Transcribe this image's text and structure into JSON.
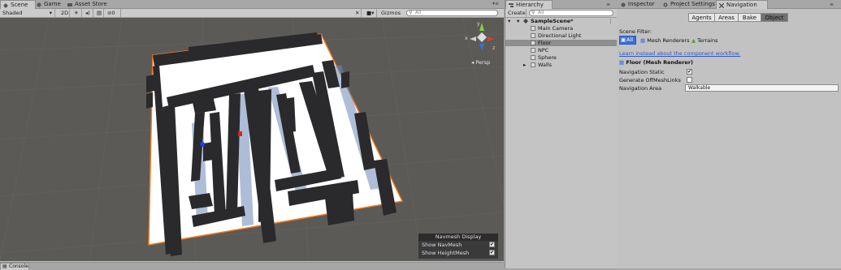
{
  "scene_tabs": {
    "scene": "Scene",
    "game": "Game",
    "asset_store": "Asset Store"
  },
  "scene_toolbar": {
    "shading": "Shaded",
    "mode_2d": "2D",
    "gizmos": "Gizmos",
    "search_placeholder": "All"
  },
  "scene_view": {
    "projection": "Persp",
    "axis_y": "y",
    "axis_x": "x",
    "axis_z": "z"
  },
  "navmesh_display": {
    "title": "Navmesh Display",
    "show_navmesh": "Show NavMesh",
    "show_navmesh_checked": true,
    "show_heightmesh": "Show HeightMesh",
    "show_heightmesh_checked": true
  },
  "console_tab": "Console",
  "hierarchy": {
    "title": "Hierarchy",
    "create": "Create",
    "search_placeholder": "All",
    "scene_name": "SampleScene*",
    "items": [
      {
        "label": "Main Camera",
        "selected": false
      },
      {
        "label": "Directional Light",
        "selected": false
      },
      {
        "label": "Floor",
        "selected": true
      },
      {
        "label": "NPC",
        "selected": false
      },
      {
        "label": "Sphere",
        "selected": false
      },
      {
        "label": "Walls",
        "selected": false,
        "expandable": true
      }
    ]
  },
  "right_tabs": {
    "inspector": "Inspector",
    "project_settings": "Project Settings",
    "navigation": "Navigation"
  },
  "navigation": {
    "tabs": [
      "Agents",
      "Areas",
      "Bake",
      "Object"
    ],
    "selected_tab": "Object",
    "scene_filter_label": "Scene Filter:",
    "filters": [
      "All",
      "Mesh Renderers",
      "Terrains"
    ],
    "link": "Learn instead about the component workflow.",
    "object_title": "Floor (Mesh Renderer)",
    "navigation_static_label": "Navigation Static",
    "navigation_static": true,
    "offmesh_label": "Generate OffMeshLinks",
    "offmesh": false,
    "area_label": "Navigation Area",
    "area_value": "Walkable"
  },
  "colors": {
    "selection_outline": "#f47a1f",
    "wall": "#2a2a2c",
    "floor": "#ffffff",
    "viewport_bg": "#5b5a57",
    "panel": "#c2c2c2",
    "accent_blue": "#2b59c3"
  }
}
